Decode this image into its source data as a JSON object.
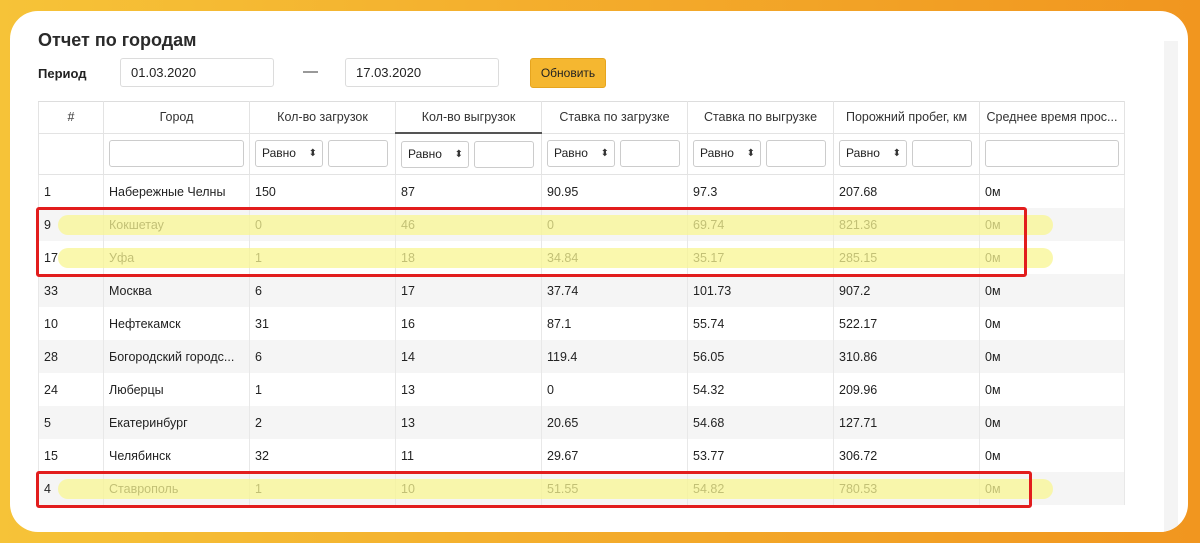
{
  "report": {
    "title": "Отчет по городам"
  },
  "period": {
    "label": "Период",
    "from": "01.03.2020",
    "separator": "—",
    "to": "17.03.2020"
  },
  "refresh_label": "Обновить",
  "filter_operator": "Равно",
  "columns": [
    "#",
    "Город",
    "Кол-во загрузок",
    "Кол-во выгрузок",
    "Ставка по загрузке",
    "Ставка по выгрузке",
    "Порожний пробег, км",
    "Среднее время прос..."
  ],
  "rows": [
    {
      "id": "1",
      "city": "Набережные Челны",
      "loads": "150",
      "unloads": "87",
      "load_rate": "90.95",
      "unload_rate": "97.3",
      "empty_run": "207.68",
      "avg_time": "0м"
    },
    {
      "id": "9",
      "city": "Кокшетау",
      "loads": "0",
      "unloads": "46",
      "load_rate": "0",
      "unload_rate": "69.74",
      "empty_run": "821.36",
      "avg_time": "0м"
    },
    {
      "id": "17",
      "city": "Уфа",
      "loads": "1",
      "unloads": "18",
      "load_rate": "34.84",
      "unload_rate": "35.17",
      "empty_run": "285.15",
      "avg_time": "0м"
    },
    {
      "id": "33",
      "city": "Москва",
      "loads": "6",
      "unloads": "17",
      "load_rate": "37.74",
      "unload_rate": "101.73",
      "empty_run": "907.2",
      "avg_time": "0м"
    },
    {
      "id": "10",
      "city": "Нефтекамск",
      "loads": "31",
      "unloads": "16",
      "load_rate": "87.1",
      "unload_rate": "55.74",
      "empty_run": "522.17",
      "avg_time": "0м"
    },
    {
      "id": "28",
      "city": "Богородский городс...",
      "loads": "6",
      "unloads": "14",
      "load_rate": "119.4",
      "unload_rate": "56.05",
      "empty_run": "310.86",
      "avg_time": "0м"
    },
    {
      "id": "24",
      "city": "Люберцы",
      "loads": "1",
      "unloads": "13",
      "load_rate": "0",
      "unload_rate": "54.32",
      "empty_run": "209.96",
      "avg_time": "0м"
    },
    {
      "id": "5",
      "city": "Екатеринбург",
      "loads": "2",
      "unloads": "13",
      "load_rate": "20.65",
      "unload_rate": "54.68",
      "empty_run": "127.71",
      "avg_time": "0м"
    },
    {
      "id": "15",
      "city": "Челябинск",
      "loads": "32",
      "unloads": "11",
      "load_rate": "29.67",
      "unload_rate": "53.77",
      "empty_run": "306.72",
      "avg_time": "0м"
    },
    {
      "id": "4",
      "city": "Ставрополь",
      "loads": "1",
      "unloads": "10",
      "load_rate": "51.55",
      "unload_rate": "54.82",
      "empty_run": "780.53",
      "avg_time": "0м"
    }
  ],
  "highlighted_row_ids": [
    "9",
    "17",
    "4"
  ],
  "colors": {
    "accent_button": "#f5b730",
    "highlight_marker": "#f8f591",
    "annotation_box": "#e21d1d",
    "background_gradient_start": "#f6c338",
    "background_gradient_end": "#f1961f"
  }
}
